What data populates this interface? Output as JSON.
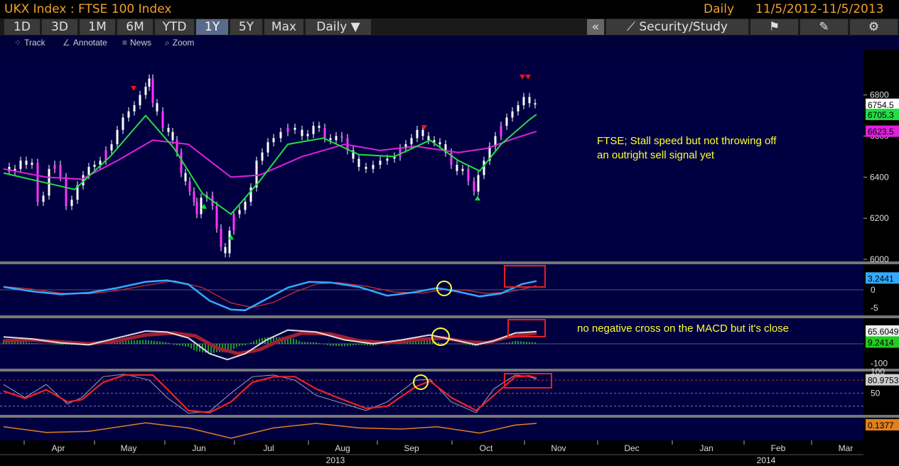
{
  "header": {
    "title": "UKX Index : FTSE 100 Index",
    "period": "Daily",
    "date_range": "11/5/2012-11/5/2013"
  },
  "toolbar": {
    "ranges": [
      "1D",
      "3D",
      "1M",
      "6M",
      "YTD",
      "1Y",
      "5Y",
      "Max"
    ],
    "active_range": "1Y",
    "frequency": "Daily",
    "collapse_label": "«",
    "security_study_label": "Security/Study",
    "chevron": "▼",
    "icons": [
      "flag-icon",
      "edit-icon",
      "gear-icon"
    ]
  },
  "subtoolbar": {
    "track": "Track",
    "annotate": "Annotate",
    "news": "News",
    "zoom": "Zoom"
  },
  "annotations": {
    "main_line1": "FTSE; Stall speed but not throwing off",
    "main_line2": "an outright sell signal yet",
    "macd_note": "no negative cross on the MACD but it's close"
  },
  "colors": {
    "panel_bg": "#000040",
    "price_up": "#ffffff",
    "price_highlight": "#ff33ff",
    "ma_fast": "#22dd44",
    "ma_slow": "#dd22dd",
    "macd_blue": "#33aaff",
    "signal_red": "#d03030",
    "note_yellow": "#ffff33",
    "stoch_red": "#ee2222",
    "orange": "#e08020"
  },
  "chart_data": [
    {
      "type": "line",
      "panel": "price",
      "x_ticks": [
        "Apr",
        "May",
        "Jun",
        "Jul",
        "Aug",
        "Sep",
        "Oct",
        "Nov",
        "Dec",
        "Jan",
        "Feb",
        "Mar"
      ],
      "x_years": [
        "2013",
        "2014"
      ],
      "y_ticks": [
        6000,
        6200,
        6400,
        6600,
        6800
      ],
      "ylim": [
        5990,
        7020
      ],
      "price_points": [
        [
          0,
          6450
        ],
        [
          8,
          6430
        ],
        [
          16,
          6440
        ],
        [
          24,
          6480
        ],
        [
          32,
          6460
        ],
        [
          40,
          6470
        ],
        [
          48,
          6280
        ],
        [
          56,
          6310
        ],
        [
          64,
          6440
        ],
        [
          72,
          6460
        ],
        [
          80,
          6400
        ],
        [
          88,
          6260
        ],
        [
          96,
          6290
        ],
        [
          104,
          6360
        ],
        [
          112,
          6410
        ],
        [
          120,
          6450
        ],
        [
          128,
          6460
        ],
        [
          136,
          6480
        ],
        [
          144,
          6530
        ],
        [
          152,
          6560
        ],
        [
          160,
          6630
        ],
        [
          168,
          6690
        ],
        [
          176,
          6720
        ],
        [
          184,
          6750
        ],
        [
          192,
          6800
        ],
        [
          200,
          6840
        ],
        [
          205,
          6880
        ],
        [
          210,
          6760
        ],
        [
          216,
          6720
        ],
        [
          224,
          6640
        ],
        [
          232,
          6620
        ],
        [
          238,
          6580
        ],
        [
          244,
          6520
        ],
        [
          250,
          6420
        ],
        [
          256,
          6380
        ],
        [
          262,
          6330
        ],
        [
          268,
          6280
        ],
        [
          272,
          6220
        ],
        [
          278,
          6300
        ],
        [
          286,
          6310
        ],
        [
          294,
          6260
        ],
        [
          300,
          6150
        ],
        [
          306,
          6060
        ],
        [
          312,
          6030
        ],
        [
          318,
          6140
        ],
        [
          324,
          6220
        ],
        [
          332,
          6240
        ],
        [
          340,
          6280
        ],
        [
          348,
          6350
        ],
        [
          356,
          6480
        ],
        [
          364,
          6520
        ],
        [
          372,
          6570
        ],
        [
          380,
          6590
        ],
        [
          390,
          6620
        ],
        [
          400,
          6640
        ],
        [
          410,
          6630
        ],
        [
          420,
          6600
        ],
        [
          428,
          6610
        ],
        [
          436,
          6650
        ],
        [
          444,
          6640
        ],
        [
          452,
          6590
        ],
        [
          460,
          6580
        ],
        [
          468,
          6600
        ],
        [
          476,
          6590
        ],
        [
          484,
          6530
        ],
        [
          492,
          6490
        ],
        [
          500,
          6450
        ],
        [
          510,
          6440
        ],
        [
          520,
          6460
        ],
        [
          530,
          6480
        ],
        [
          540,
          6490
        ],
        [
          550,
          6500
        ],
        [
          558,
          6540
        ],
        [
          566,
          6560
        ],
        [
          574,
          6590
        ],
        [
          582,
          6630
        ],
        [
          590,
          6600
        ],
        [
          598,
          6580
        ],
        [
          606,
          6570
        ],
        [
          614,
          6560
        ],
        [
          622,
          6520
        ],
        [
          630,
          6460
        ],
        [
          638,
          6430
        ],
        [
          646,
          6440
        ],
        [
          654,
          6380
        ],
        [
          662,
          6330
        ],
        [
          668,
          6410
        ],
        [
          676,
          6480
        ],
        [
          684,
          6550
        ],
        [
          692,
          6600
        ],
        [
          700,
          6650
        ],
        [
          708,
          6690
        ],
        [
          716,
          6720
        ],
        [
          724,
          6750
        ],
        [
          732,
          6790
        ],
        [
          740,
          6760
        ],
        [
          748,
          6755
        ]
      ],
      "series": [
        {
          "name": "6754.5",
          "value": 6754.5
        },
        {
          "name": "6705.3",
          "value": 6705.3
        },
        {
          "name": "6623.5",
          "value": 6623.5
        }
      ],
      "ma_fast_points": [
        [
          0,
          6420
        ],
        [
          50,
          6380
        ],
        [
          100,
          6340
        ],
        [
          150,
          6500
        ],
        [
          200,
          6700
        ],
        [
          240,
          6540
        ],
        [
          280,
          6320
        ],
        [
          320,
          6220
        ],
        [
          360,
          6380
        ],
        [
          400,
          6560
        ],
        [
          450,
          6590
        ],
        [
          500,
          6510
        ],
        [
          550,
          6500
        ],
        [
          600,
          6580
        ],
        [
          640,
          6480
        ],
        [
          670,
          6430
        ],
        [
          700,
          6560
        ],
        [
          740,
          6680
        ],
        [
          750,
          6705
        ]
      ],
      "ma_slow_points": [
        [
          0,
          6440
        ],
        [
          60,
          6400
        ],
        [
          110,
          6390
        ],
        [
          160,
          6480
        ],
        [
          210,
          6580
        ],
        [
          260,
          6560
        ],
        [
          320,
          6400
        ],
        [
          360,
          6410
        ],
        [
          420,
          6500
        ],
        [
          480,
          6560
        ],
        [
          530,
          6530
        ],
        [
          580,
          6550
        ],
        [
          640,
          6520
        ],
        [
          680,
          6540
        ],
        [
          720,
          6590
        ],
        [
          750,
          6623
        ]
      ],
      "signal_markers": [
        {
          "type": "down",
          "x": 183,
          "y": 6830
        },
        {
          "type": "up",
          "x": 282,
          "y": 6260
        },
        {
          "type": "up",
          "x": 320,
          "y": 6110
        },
        {
          "type": "down",
          "x": 592,
          "y": 6640
        },
        {
          "type": "up",
          "x": 667,
          "y": 6300
        },
        {
          "type": "down",
          "x": 730,
          "y": 6885
        },
        {
          "type": "down",
          "x": 738,
          "y": 6885
        }
      ]
    },
    {
      "type": "line",
      "panel": "macd",
      "y_ticks": [
        0,
        -5
      ],
      "ylim": [
        -7,
        7
      ],
      "series": [
        {
          "name": "3.2441",
          "value": 3.2441
        }
      ],
      "macd_points": [
        [
          0,
          0.8
        ],
        [
          40,
          -0.4
        ],
        [
          80,
          -1.2
        ],
        [
          120,
          -0.8
        ],
        [
          160,
          0.5
        ],
        [
          200,
          2.2
        ],
        [
          230,
          2.6
        ],
        [
          260,
          1.5
        ],
        [
          290,
          -3.0
        ],
        [
          320,
          -5.4
        ],
        [
          340,
          -5.6
        ],
        [
          370,
          -2.5
        ],
        [
          400,
          0.6
        ],
        [
          430,
          2.2
        ],
        [
          460,
          2.0
        ],
        [
          500,
          0.8
        ],
        [
          540,
          -1.6
        ],
        [
          580,
          -0.6
        ],
        [
          610,
          0.5
        ],
        [
          640,
          -0.5
        ],
        [
          670,
          -1.8
        ],
        [
          700,
          -1.0
        ],
        [
          730,
          1.6
        ],
        [
          750,
          2.4
        ]
      ],
      "signal_points": [
        [
          0,
          0.9
        ],
        [
          40,
          0.2
        ],
        [
          80,
          -0.9
        ],
        [
          120,
          -1.1
        ],
        [
          160,
          -0.2
        ],
        [
          200,
          1.2
        ],
        [
          240,
          2.5
        ],
        [
          280,
          0.6
        ],
        [
          320,
          -3.6
        ],
        [
          350,
          -4.8
        ],
        [
          380,
          -3.4
        ],
        [
          410,
          -0.6
        ],
        [
          440,
          1.6
        ],
        [
          470,
          2.0
        ],
        [
          510,
          1.0
        ],
        [
          550,
          -0.6
        ],
        [
          590,
          -0.9
        ],
        [
          620,
          0.1
        ],
        [
          650,
          -0.1
        ],
        [
          680,
          -1.0
        ],
        [
          710,
          -0.6
        ],
        [
          740,
          0.6
        ],
        [
          750,
          1.2
        ]
      ],
      "marker": "circle"
    },
    {
      "type": "area",
      "panel": "histogram",
      "y_ticks": [
        0,
        -100
      ],
      "ylim": [
        -130,
        130
      ],
      "series": [
        {
          "name": "65.6049",
          "value": 65.6049
        },
        {
          "name": "9.2414",
          "value": 9.2414
        }
      ],
      "line_a": [
        [
          0,
          35
        ],
        [
          40,
          25
        ],
        [
          80,
          5
        ],
        [
          120,
          -5
        ],
        [
          160,
          30
        ],
        [
          200,
          65
        ],
        [
          230,
          60
        ],
        [
          260,
          30
        ],
        [
          290,
          -50
        ],
        [
          315,
          -80
        ],
        [
          340,
          -50
        ],
        [
          370,
          20
        ],
        [
          400,
          70
        ],
        [
          440,
          60
        ],
        [
          480,
          20
        ],
        [
          520,
          0
        ],
        [
          560,
          20
        ],
        [
          600,
          45
        ],
        [
          640,
          15
        ],
        [
          665,
          -5
        ],
        [
          690,
          15
        ],
        [
          720,
          55
        ],
        [
          750,
          62
        ]
      ],
      "line_b": [
        [
          0,
          15
        ],
        [
          40,
          20
        ],
        [
          80,
          10
        ],
        [
          120,
          0
        ],
        [
          160,
          15
        ],
        [
          200,
          45
        ],
        [
          240,
          55
        ],
        [
          270,
          40
        ],
        [
          300,
          -20
        ],
        [
          330,
          -50
        ],
        [
          360,
          -30
        ],
        [
          390,
          20
        ],
        [
          420,
          55
        ],
        [
          460,
          50
        ],
        [
          500,
          15
        ],
        [
          540,
          5
        ],
        [
          580,
          20
        ],
        [
          620,
          30
        ],
        [
          650,
          10
        ],
        [
          680,
          5
        ],
        [
          710,
          35
        ],
        [
          740,
          50
        ],
        [
          750,
          55
        ]
      ]
    },
    {
      "type": "line",
      "panel": "stochastic",
      "y_ticks": [
        100,
        50
      ],
      "ylim": [
        0,
        100
      ],
      "series": [
        {
          "name": "80.9753",
          "value": 80.9753
        }
      ],
      "red_points": [
        [
          0,
          55
        ],
        [
          30,
          38
        ],
        [
          60,
          58
        ],
        [
          90,
          30
        ],
        [
          110,
          35
        ],
        [
          140,
          75
        ],
        [
          170,
          92
        ],
        [
          210,
          92
        ],
        [
          230,
          60
        ],
        [
          260,
          10
        ],
        [
          290,
          5
        ],
        [
          320,
          30
        ],
        [
          350,
          75
        ],
        [
          380,
          88
        ],
        [
          410,
          88
        ],
        [
          440,
          60
        ],
        [
          470,
          40
        ],
        [
          510,
          15
        ],
        [
          540,
          20
        ],
        [
          580,
          65
        ],
        [
          600,
          78
        ],
        [
          630,
          40
        ],
        [
          665,
          10
        ],
        [
          690,
          45
        ],
        [
          720,
          88
        ],
        [
          740,
          90
        ],
        [
          750,
          85
        ]
      ],
      "gray_points": [
        [
          0,
          70
        ],
        [
          30,
          40
        ],
        [
          60,
          70
        ],
        [
          90,
          25
        ],
        [
          110,
          40
        ],
        [
          140,
          88
        ],
        [
          170,
          94
        ],
        [
          205,
          80
        ],
        [
          230,
          40
        ],
        [
          260,
          4
        ],
        [
          290,
          8
        ],
        [
          320,
          50
        ],
        [
          350,
          88
        ],
        [
          380,
          92
        ],
        [
          410,
          80
        ],
        [
          440,
          45
        ],
        [
          470,
          30
        ],
        [
          510,
          10
        ],
        [
          540,
          30
        ],
        [
          580,
          80
        ],
        [
          600,
          82
        ],
        [
          630,
          30
        ],
        [
          665,
          5
        ],
        [
          690,
          60
        ],
        [
          720,
          92
        ],
        [
          740,
          88
        ],
        [
          750,
          82
        ]
      ]
    },
    {
      "type": "line",
      "panel": "oscillator",
      "series": [
        {
          "name": "0.1377",
          "value": 0.1377
        }
      ],
      "ylim": [
        -1,
        1
      ],
      "points": [
        [
          0,
          0.2
        ],
        [
          60,
          -0.3
        ],
        [
          120,
          -0.2
        ],
        [
          200,
          0.55
        ],
        [
          260,
          0.1
        ],
        [
          320,
          -0.8
        ],
        [
          380,
          0.1
        ],
        [
          440,
          0.5
        ],
        [
          500,
          0.1
        ],
        [
          560,
          0.0
        ],
        [
          610,
          0.2
        ],
        [
          670,
          -0.35
        ],
        [
          720,
          0.35
        ],
        [
          750,
          0.5
        ]
      ]
    }
  ]
}
